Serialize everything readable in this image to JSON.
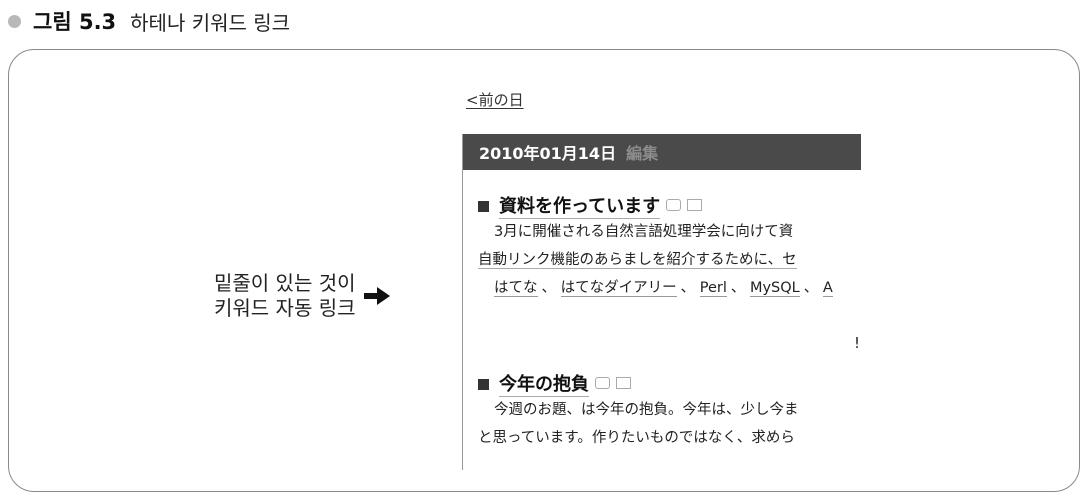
{
  "caption": {
    "label": "그림 5.3",
    "title": "하테나 키워드 링크"
  },
  "note": {
    "line1": "밑줄이 있는 것이",
    "line2": "키워드 자동 링크"
  },
  "blog": {
    "prev_link": "<前の日",
    "date_header": "2010年01月14日",
    "edit_link": "編集",
    "entries": [
      {
        "title": "資料を作っています",
        "line1": "3月に開催される自然言語処理学会に向けて資",
        "line2": "自動リンク機能のあらましを紹介するために、セ",
        "keywords": [
          "はてな",
          "はてなダイアリー",
          "Perl",
          "MySQL",
          "A"
        ],
        "separator": "、",
        "trailing": "!"
      },
      {
        "title": "今年の抱負",
        "line1": "今週のお題、は今年の抱負。今年は、少し今ま",
        "line2": "と思っています。作りたいものではなく、求めら"
      }
    ]
  }
}
